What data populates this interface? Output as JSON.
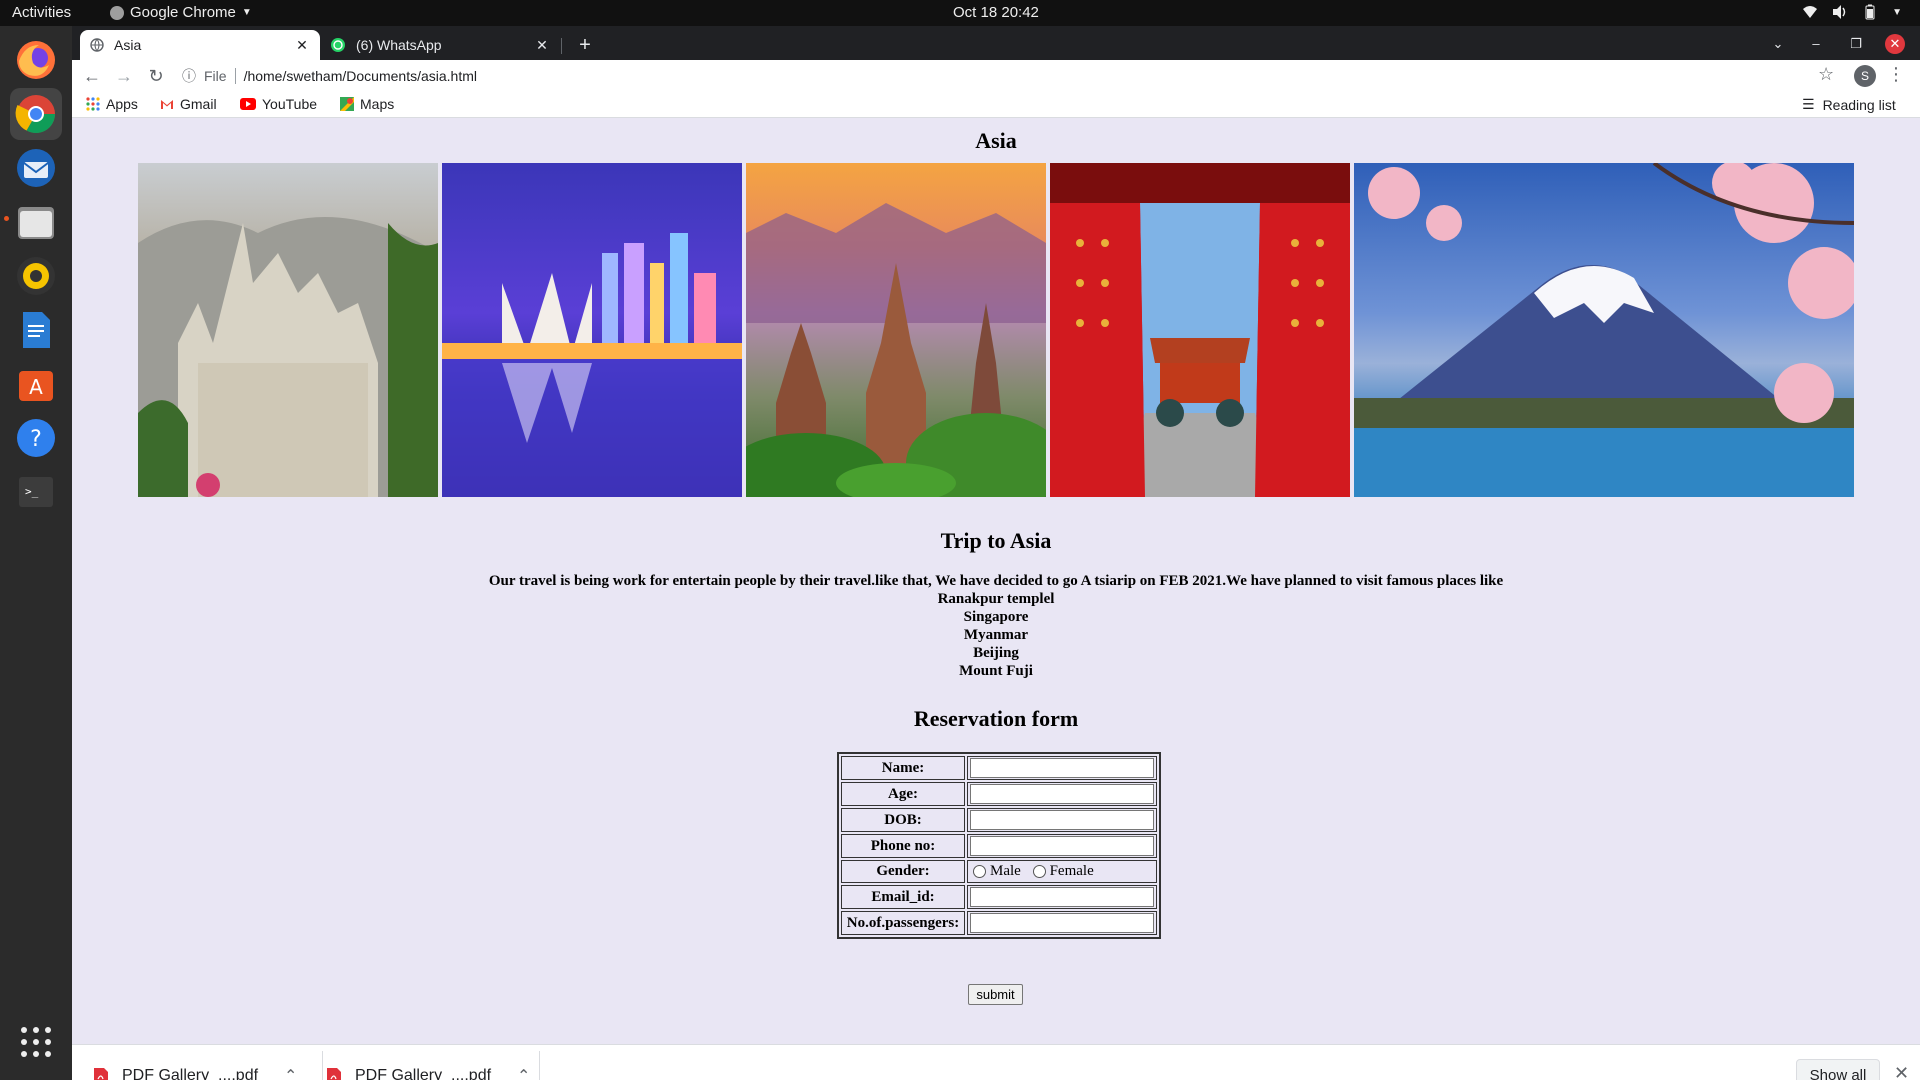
{
  "topbar": {
    "activities": "Activities",
    "app_name": "Google Chrome",
    "clock": "Oct 18  20:42"
  },
  "dock": {
    "items": [
      "Firefox",
      "Google Chrome",
      "Thunderbird",
      "Files",
      "Rhythmbox",
      "LibreOffice Writer",
      "Ubuntu Software",
      "Help",
      "Terminal",
      "Show Applications"
    ]
  },
  "tabs": [
    {
      "title": "Asia",
      "active": true
    },
    {
      "title": "(6) WhatsApp",
      "active": false
    }
  ],
  "toolbar": {
    "scheme_label": "File",
    "url": "/home/swetham/Documents/asia.html",
    "profile_initial": "S"
  },
  "bookmarks": {
    "items": [
      "Apps",
      "Gmail",
      "YouTube",
      "Maps"
    ],
    "reading_list": "Reading list"
  },
  "page": {
    "heading": "Asia",
    "photos": [
      "Ranakpur temple",
      "Singapore skyline",
      "Myanmar pagodas",
      "Beijing Forbidden City gate",
      "Mount Fuji"
    ],
    "trip_title": "Trip to Asia",
    "intro": "Our travel is being work for entertain people by their travel.like that, We have decided to go A tsiarip on FEB 2021.We have planned to visit famous places like",
    "places": [
      "Ranakpur templel",
      "Singapore",
      "Myanmar",
      "Beijing",
      "Mount Fuji"
    ],
    "form_title": "Reservation form",
    "form": {
      "name_label": "Name:",
      "age_label": "Age:",
      "dob_label": "DOB:",
      "phone_label": "Phone no:",
      "gender_label": "Gender:",
      "gender_male": "Male",
      "gender_female": "Female",
      "email_label": "Email_id:",
      "passengers_label": "No.of.passengers:",
      "submit_label": "submit"
    }
  },
  "downloads": {
    "items": [
      "PDF Gallery_....pdf",
      "PDF Gallery_....pdf"
    ],
    "show_all": "Show all"
  }
}
